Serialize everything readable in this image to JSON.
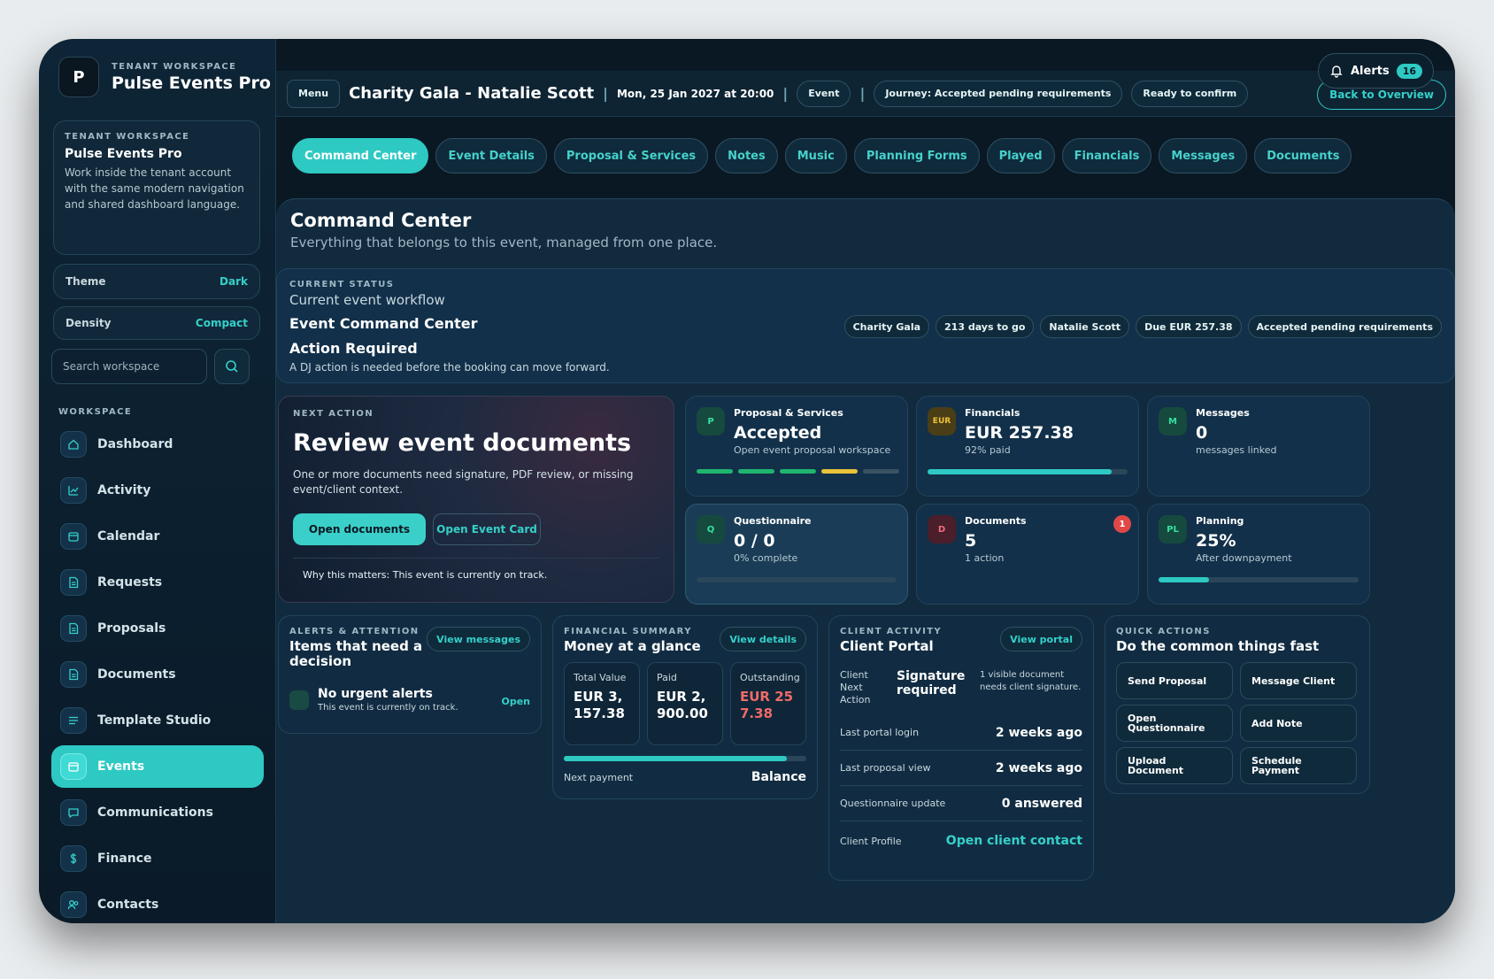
{
  "sidebar": {
    "brand": {
      "logo": "P",
      "eyebrow": "TENANT WORKSPACE",
      "name": "Pulse Events Pro"
    },
    "workspace_card": {
      "eyebrow": "TENANT WORKSPACE",
      "title": "Pulse Events Pro",
      "desc": "Work inside the tenant account with the same modern navigation and shared dashboard language."
    },
    "theme": {
      "label": "Theme",
      "value": "Dark"
    },
    "density": {
      "label": "Density",
      "value": "Compact"
    },
    "search_placeholder": "Search workspace",
    "nav_heading": "WORKSPACE",
    "items": [
      {
        "label": "Dashboard",
        "icon": "home-icon"
      },
      {
        "label": "Activity",
        "icon": "chart-icon"
      },
      {
        "label": "Calendar",
        "icon": "calendar-icon"
      },
      {
        "label": "Requests",
        "icon": "document-icon"
      },
      {
        "label": "Proposals",
        "icon": "document-icon"
      },
      {
        "label": "Documents",
        "icon": "document-icon"
      },
      {
        "label": "Template Studio",
        "icon": "list-icon"
      },
      {
        "label": "Events",
        "icon": "calendar-icon",
        "active": true
      },
      {
        "label": "Communications",
        "icon": "chat-icon"
      },
      {
        "label": "Finance",
        "icon": "dollar-icon"
      },
      {
        "label": "Contacts",
        "icon": "users-icon"
      }
    ]
  },
  "topbar": {
    "menu": "Menu",
    "title": "Charity Gala - Natalie Scott",
    "sep": "|",
    "date": "Mon, 25 Jan 2027 at 20:00",
    "type": "Event",
    "journey": "Journey: Accepted pending requirements",
    "ready": "Ready to confirm",
    "alerts_label": "Alerts",
    "alerts_count": "16",
    "back": "Back to Overview"
  },
  "tabs": [
    "Command Center",
    "Event Details",
    "Proposal & Services",
    "Notes",
    "Music",
    "Planning Forms",
    "Played",
    "Financials",
    "Messages",
    "Documents"
  ],
  "command_center": {
    "title": "Command Center",
    "subtitle": "Everything that belongs to this event, managed from one place."
  },
  "status": {
    "eyebrow": "CURRENT STATUS",
    "sub": "Current event workflow",
    "h1": "Event Command Center",
    "h2": "Action Required",
    "desc": "A DJ action is needed before the booking can move forward.",
    "tags": [
      "Charity Gala",
      "213 days to go",
      "Natalie Scott",
      "Due EUR 257.38",
      "Accepted pending requirements"
    ]
  },
  "next_action": {
    "eyebrow": "NEXT ACTION",
    "title": "Review event documents",
    "desc": "One or more documents need signature, PDF review, or missing event/client context.",
    "primary": "Open documents",
    "secondary": "Open Event Card",
    "why": "Why this matters: This event is currently on track."
  },
  "metrics": {
    "proposal": {
      "avatar": "P",
      "label": "Proposal & Services",
      "value": "Accepted",
      "sub": "Open event proposal workspace",
      "segments": [
        "#1fb56e",
        "#1fb56e",
        "#1fb56e",
        "#e8c23a",
        "#3a5262"
      ]
    },
    "financials": {
      "avatar": "EUR",
      "label": "Financials",
      "value": "EUR 257.38",
      "sub": "92% paid",
      "progress": 92
    },
    "messages": {
      "avatar": "M",
      "label": "Messages",
      "value": "0",
      "sub": "messages linked"
    },
    "questionnaire": {
      "avatar": "Q",
      "label": "Questionnaire",
      "value": "0 / 0",
      "sub": "0% complete",
      "progress": 0
    },
    "documents": {
      "avatar": "D",
      "label": "Documents",
      "value": "5",
      "sub": "1 action",
      "badge": "1"
    },
    "planning": {
      "avatar": "PL",
      "label": "Planning",
      "value": "25%",
      "sub": "After downpayment",
      "progress": 25
    }
  },
  "alerts_panel": {
    "eyebrow": "ALERTS & ATTENTION",
    "title": "Items that need a decision",
    "button": "View messages",
    "item_title": "No urgent alerts",
    "item_sub": "This event is currently on track.",
    "item_action": "Open"
  },
  "financial_summary": {
    "eyebrow": "FINANCIAL SUMMARY",
    "title": "Money at a glance",
    "button": "View details",
    "total_label": "Total Value",
    "total_value": "EUR 3,157.38",
    "paid_label": "Paid",
    "paid_value": "EUR 2,900.00",
    "out_label": "Outstanding",
    "out_value": "EUR 257.38",
    "paid_progress": 92,
    "next_label": "Next payment",
    "next_value": "Balance"
  },
  "client_activity": {
    "eyebrow": "CLIENT ACTIVITY",
    "title": "Client Portal",
    "button": "View portal",
    "cna_label": "Client Next Action",
    "cna_value": "Signature required",
    "cna_note": "1 visible document needs client signature.",
    "rows": [
      {
        "label": "Last portal login",
        "value": "2 weeks ago"
      },
      {
        "label": "Last proposal view",
        "value": "2 weeks ago"
      },
      {
        "label": "Questionnaire update",
        "value": "0 answered"
      }
    ],
    "profile_label": "Client Profile",
    "profile_value": "Open client contact"
  },
  "quick_actions": {
    "eyebrow": "QUICK ACTIONS",
    "title": "Do the common things fast",
    "items": [
      "Send Proposal",
      "Message Client",
      "Open Questionnaire",
      "Add Note",
      "Upload Document",
      "Schedule Payment"
    ]
  }
}
